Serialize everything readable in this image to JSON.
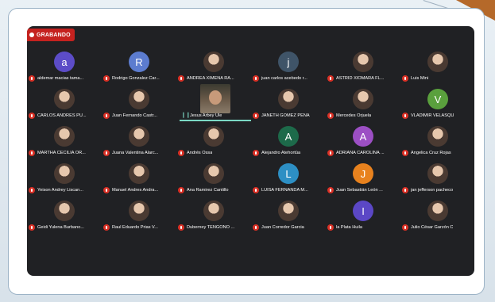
{
  "recording": {
    "label": "GRABANDO"
  },
  "colors": {
    "recording": "#c5221f",
    "mic_muted": "#d93025",
    "speaking": "#7bd8c4",
    "meeting_bg": "#202124"
  },
  "participants": [
    {
      "name": "aldemar macias tama...",
      "initial": "a",
      "avatar_color": "#5c4cc7",
      "muted": true
    },
    {
      "name": "Rodrigo Gonzalez Car...",
      "initial": "R",
      "avatar_color": "#5c7ccf",
      "muted": true
    },
    {
      "name": "ANDREA XIMENA RA...",
      "initial": "",
      "avatar_color": "",
      "muted": true
    },
    {
      "name": "juan carlos acebedo r...",
      "initial": "j",
      "avatar_color": "#3f5468",
      "muted": true
    },
    {
      "name": "ASTRID XIOMARA FL...",
      "initial": "",
      "avatar_color": "",
      "muted": true
    },
    {
      "name": "Luis Mini",
      "initial": "",
      "avatar_color": "",
      "muted": true
    },
    {
      "name": "CARLOS ANDRES PU...",
      "initial": "",
      "avatar_color": "",
      "muted": true
    },
    {
      "name": "Juan Fernando Castr...",
      "initial": "",
      "avatar_color": "",
      "muted": true
    },
    {
      "name": "Jesus Arbey Ule",
      "initial": "",
      "avatar_color": "",
      "muted": false,
      "speaking": true
    },
    {
      "name": "JANETH GOMEZ PEÑA",
      "initial": "",
      "avatar_color": "",
      "muted": true
    },
    {
      "name": "Mercedes Orjuela",
      "initial": "",
      "avatar_color": "",
      "muted": true
    },
    {
      "name": "VLADIMIR VELASQU",
      "initial": "V",
      "avatar_color": "#5aa03d",
      "muted": true
    },
    {
      "name": "MARTHA CECILIA OR...",
      "initial": "",
      "avatar_color": "",
      "muted": true
    },
    {
      "name": "Juana Valentina Alarc...",
      "initial": "",
      "avatar_color": "",
      "muted": true
    },
    {
      "name": "Andrés Ossa",
      "initial": "",
      "avatar_color": "",
      "muted": true
    },
    {
      "name": "Alejandro Atehortúa",
      "initial": "A",
      "avatar_color": "#1d6a4a",
      "muted": true
    },
    {
      "name": "ADRIANA CAROLINA ...",
      "initial": "A",
      "avatar_color": "#9c4fc4",
      "muted": true
    },
    {
      "name": "Angelica Cruz Rojas",
      "initial": "",
      "avatar_color": "",
      "muted": true
    },
    {
      "name": "Yeison Andrey Liscan...",
      "initial": "",
      "avatar_color": "",
      "muted": true
    },
    {
      "name": "Manuel Andres Andra...",
      "initial": "",
      "avatar_color": "",
      "muted": true
    },
    {
      "name": "Ana Ramirez Cantillo",
      "initial": "",
      "avatar_color": "",
      "muted": true
    },
    {
      "name": "LUISA FERNANDA M...",
      "initial": "L",
      "avatar_color": "#2d8fc4",
      "muted": true
    },
    {
      "name": "Juan Sebastián León ...",
      "initial": "J",
      "avatar_color": "#e8821e",
      "muted": true
    },
    {
      "name": "jan jefferson pacheco",
      "initial": "",
      "avatar_color": "",
      "muted": true
    },
    {
      "name": "Geidi Yulena Burbano...",
      "initial": "",
      "avatar_color": "",
      "muted": true
    },
    {
      "name": "Raul Eduardo Prias V...",
      "initial": "",
      "avatar_color": "",
      "muted": true
    },
    {
      "name": "Duberney TENGONO ...",
      "initial": "",
      "avatar_color": "",
      "muted": true
    },
    {
      "name": "Juan Corredor Garcia",
      "initial": "",
      "avatar_color": "",
      "muted": true
    },
    {
      "name": "la Plata Huila",
      "initial": "I",
      "avatar_color": "#5b47c6",
      "muted": true
    },
    {
      "name": "Julio César Garzón C",
      "initial": "",
      "avatar_color": "",
      "muted": true
    }
  ]
}
